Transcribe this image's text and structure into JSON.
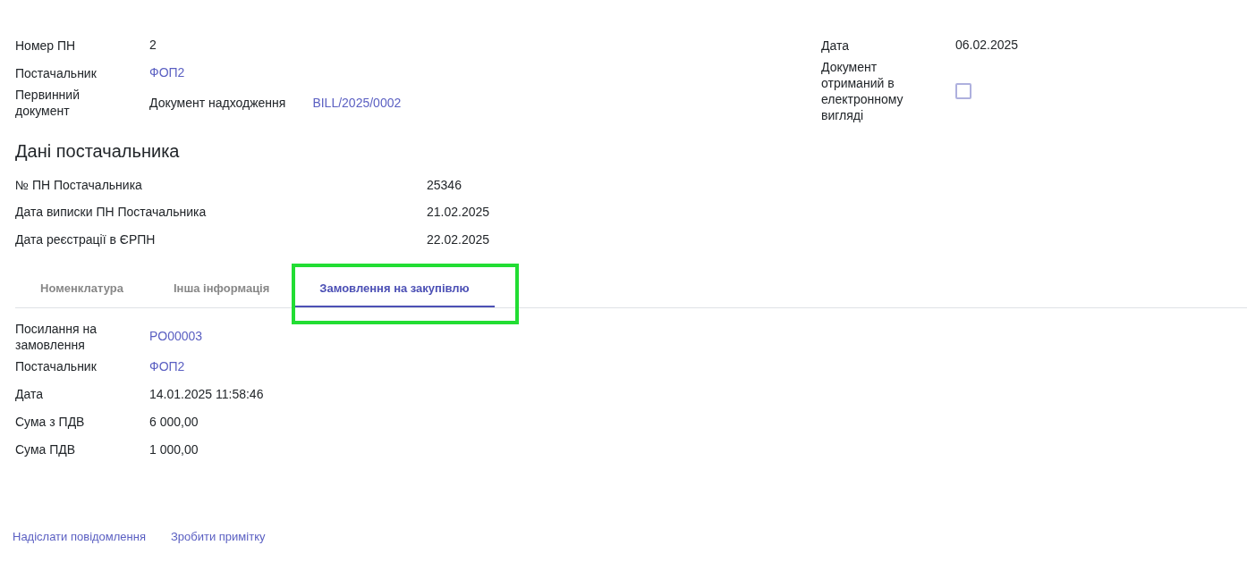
{
  "header_left": [
    {
      "kind": "text",
      "label": "Номер ПН",
      "value": "2"
    },
    {
      "kind": "link",
      "label": "Постачальник",
      "value": "ФОП2"
    },
    {
      "kind": "pair",
      "label": "Первинний документ",
      "value": "Документ надходження",
      "link": "BILL/2025/0002"
    }
  ],
  "header_right": [
    {
      "kind": "text",
      "label": "Дата",
      "value": "06.02.2025"
    },
    {
      "kind": "checkbox",
      "label": "Документ отриманий в електронному вигляді",
      "checked": false
    }
  ],
  "supplier_section": {
    "title": "Дані постачальника",
    "fields": [
      {
        "label": "№ ПН Постачальника",
        "value": "25346"
      },
      {
        "label": "Дата виписки ПН Постачальника",
        "value": "21.02.2025"
      },
      {
        "label": "Дата реєстрації в ЄРПН",
        "value": "22.02.2025"
      }
    ]
  },
  "tabs": [
    {
      "label": "Номенклатура",
      "selected": false,
      "highlighted": false
    },
    {
      "label": "Інша інформація",
      "selected": false,
      "highlighted": false
    },
    {
      "label": "Замовлення на закупівлю",
      "selected": true,
      "highlighted": true
    }
  ],
  "order_fields": [
    {
      "kind": "link",
      "label": "Посилання на замовлення",
      "value": "PO00003"
    },
    {
      "kind": "link",
      "label": "Постачальник",
      "value": "ФОП2"
    },
    {
      "kind": "text",
      "label": "Дата",
      "value": "14.01.2025 11:58:46"
    },
    {
      "kind": "text",
      "label": "Сума з ПДВ",
      "value": "6 000,00"
    },
    {
      "kind": "text",
      "label": "Сума ПДВ",
      "value": "1 000,00"
    }
  ],
  "footer_links": [
    "Надіслати повідомлення",
    "Зробити примітку"
  ]
}
